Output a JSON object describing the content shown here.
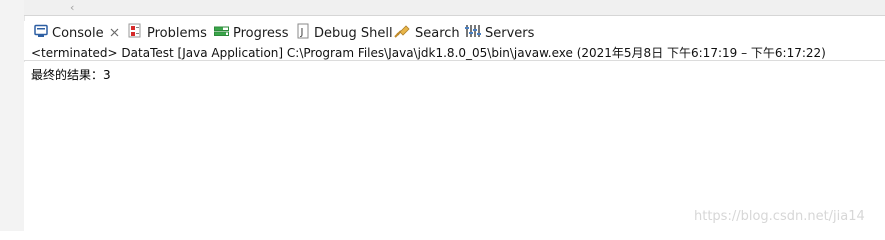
{
  "tabs": [
    {
      "label": "Console",
      "icon": "console-icon",
      "closable": true
    },
    {
      "label": "Problems",
      "icon": "problems-icon"
    },
    {
      "label": "Progress",
      "icon": "progress-icon"
    },
    {
      "label": "Debug Shell",
      "icon": "debug-shell-icon"
    },
    {
      "label": "Search",
      "icon": "search-icon"
    },
    {
      "label": "Servers",
      "icon": "servers-icon"
    }
  ],
  "scrollbar": {
    "left_arrow": "‹"
  },
  "console": {
    "status": "<terminated> DataTest [Java Application] C:\\Program Files\\Java\\jdk1.8.0_05\\bin\\javaw.exe  (2021年5月8日 下午6:17:19 – 下午6:17:22)",
    "output": "最终的结果：3"
  },
  "watermark": "https://blog.csdn.net/jia14",
  "colors": {
    "tab_text": "#1b1b1b",
    "accent_console": "#2d5fa3"
  }
}
